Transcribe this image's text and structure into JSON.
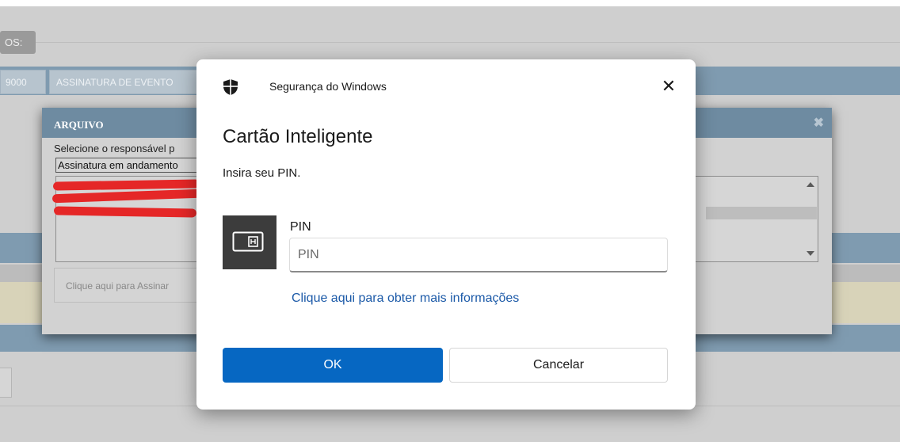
{
  "background_app": {
    "os_button_label": "OS:",
    "tabs": [
      {
        "label": "9000"
      },
      {
        "label": "ASSINATURA DE EVENTO"
      }
    ],
    "panel": {
      "title": "ARQUIVO",
      "close_icon": "close-icon",
      "select_label": "Selecione o responsável p",
      "select_value": "Assinatura em andamento",
      "sign_button_label": "Clique aqui para Assinar"
    }
  },
  "dialog": {
    "header_title": "Segurança do Windows",
    "header_icon": "shield-icon",
    "close_icon": "close-icon",
    "title": "Cartão Inteligente",
    "instruction": "Insira seu PIN.",
    "card_icon": "smart-card-icon",
    "pin_label": "PIN",
    "pin_placeholder": "PIN",
    "pin_value": "",
    "more_info_link": "Clique aqui para obter mais informações",
    "ok_label": "OK",
    "cancel_label": "Cancelar"
  },
  "colors": {
    "primary_button": "#0667c2",
    "link": "#1c5aa8",
    "redaction": "#e52727"
  }
}
